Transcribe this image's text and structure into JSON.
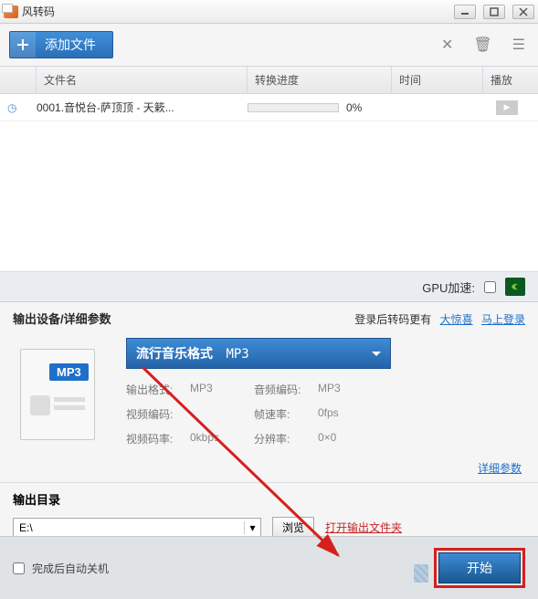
{
  "titlebar": {
    "title": "风转码"
  },
  "toolbar": {
    "add_label": "添加文件"
  },
  "columns": {
    "name": "文件名",
    "progress": "转换进度",
    "time": "时间",
    "play": "播放"
  },
  "rows": [
    {
      "name": "0001.音悦台-萨顶顶 - 天簌...",
      "pct_text": "0%",
      "pct": 0
    }
  ],
  "gpu": {
    "label": "GPU加速:"
  },
  "sections": {
    "params_title": "输出设备/详细参数",
    "login_prefix": "登录后转码更有",
    "surprise": "大惊喜",
    "login": "马上登录",
    "detail": "详细参数",
    "outdir_title": "输出目录"
  },
  "format": {
    "tag": "MP3",
    "select_main": "流行音乐格式",
    "select_sub": "MP3",
    "kv": {
      "out_fmt_k": "输出格式:",
      "out_fmt_v": "MP3",
      "audio_k": "音频编码:",
      "audio_v": "MP3",
      "vcodec_k": "视频编码:",
      "vcodec_v": "",
      "fps_k": "帧速率:",
      "fps_v": "0fps",
      "vbit_k": "视频码率:",
      "vbit_v": "0kbps",
      "res_k": "分辨率:",
      "res_v": "0×0"
    }
  },
  "output": {
    "path": "E:\\",
    "browse": "浏览",
    "open_folder": "打开输出文件夹"
  },
  "footer": {
    "shutdown": "完成后自动关机",
    "start": "开始"
  }
}
